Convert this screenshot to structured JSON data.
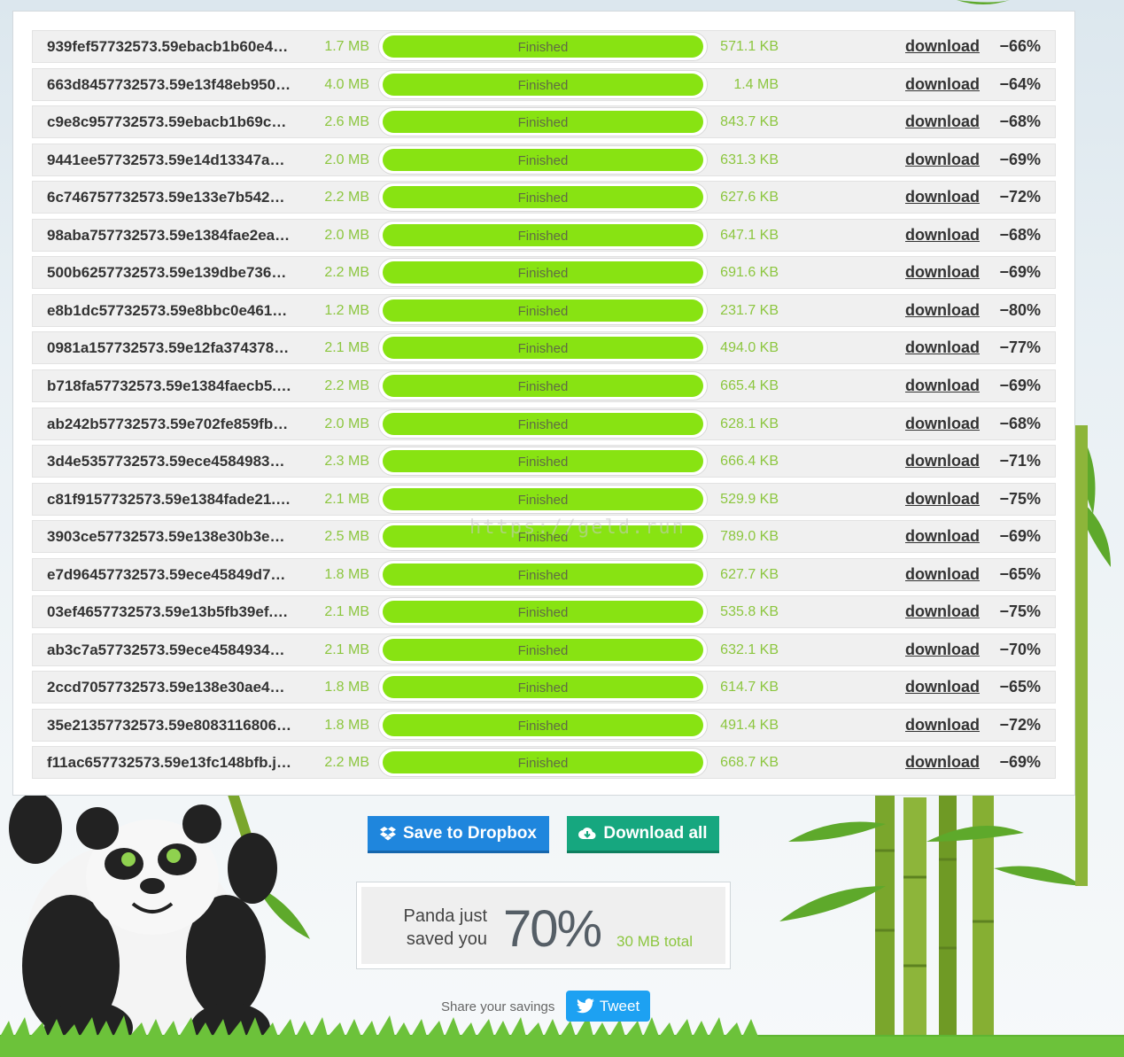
{
  "files": [
    {
      "name": "939fef57732573.59ebacb1b60e4…",
      "original": "1.7 MB",
      "status": "Finished",
      "progress": 100,
      "new_size": "571.1 KB",
      "download": "download",
      "saving": "−66%"
    },
    {
      "name": "663d8457732573.59e13f48eb950…",
      "original": "4.0 MB",
      "status": "Finished",
      "progress": 100,
      "new_size": "1.4 MB",
      "download": "download",
      "saving": "−64%"
    },
    {
      "name": "c9e8c957732573.59ebacb1b69c…",
      "original": "2.6 MB",
      "status": "Finished",
      "progress": 100,
      "new_size": "843.7 KB",
      "download": "download",
      "saving": "−68%"
    },
    {
      "name": "9441ee57732573.59e14d13347a…",
      "original": "2.0 MB",
      "status": "Finished",
      "progress": 100,
      "new_size": "631.3 KB",
      "download": "download",
      "saving": "−69%"
    },
    {
      "name": "6c746757732573.59e133e7b542…",
      "original": "2.2 MB",
      "status": "Finished",
      "progress": 100,
      "new_size": "627.6 KB",
      "download": "download",
      "saving": "−72%"
    },
    {
      "name": "98aba757732573.59e1384fae2ea…",
      "original": "2.0 MB",
      "status": "Finished",
      "progress": 100,
      "new_size": "647.1 KB",
      "download": "download",
      "saving": "−68%"
    },
    {
      "name": "500b6257732573.59e139dbe736…",
      "original": "2.2 MB",
      "status": "Finished",
      "progress": 100,
      "new_size": "691.6 KB",
      "download": "download",
      "saving": "−69%"
    },
    {
      "name": "e8b1dc57732573.59e8bbc0e461…",
      "original": "1.2 MB",
      "status": "Finished",
      "progress": 100,
      "new_size": "231.7 KB",
      "download": "download",
      "saving": "−80%"
    },
    {
      "name": "0981a157732573.59e12fa374378…",
      "original": "2.1 MB",
      "status": "Finished",
      "progress": 100,
      "new_size": "494.0 KB",
      "download": "download",
      "saving": "−77%"
    },
    {
      "name": "b718fa57732573.59e1384faecb5.…",
      "original": "2.2 MB",
      "status": "Finished",
      "progress": 100,
      "new_size": "665.4 KB",
      "download": "download",
      "saving": "−69%"
    },
    {
      "name": "ab242b57732573.59e702fe859fb…",
      "original": "2.0 MB",
      "status": "Finished",
      "progress": 100,
      "new_size": "628.1 KB",
      "download": "download",
      "saving": "−68%"
    },
    {
      "name": "3d4e5357732573.59ece4584983…",
      "original": "2.3 MB",
      "status": "Finished",
      "progress": 100,
      "new_size": "666.4 KB",
      "download": "download",
      "saving": "−71%"
    },
    {
      "name": "c81f9157732573.59e1384fade21.…",
      "original": "2.1 MB",
      "status": "Finished",
      "progress": 100,
      "new_size": "529.9 KB",
      "download": "download",
      "saving": "−75%"
    },
    {
      "name": "3903ce57732573.59e138e30b3e…",
      "original": "2.5 MB",
      "status": "Finished",
      "progress": 100,
      "new_size": "789.0 KB",
      "download": "download",
      "saving": "−69%"
    },
    {
      "name": "e7d96457732573.59ece45849d7…",
      "original": "1.8 MB",
      "status": "Finished",
      "progress": 100,
      "new_size": "627.7 KB",
      "download": "download",
      "saving": "−65%"
    },
    {
      "name": "03ef4657732573.59e13b5fb39ef.…",
      "original": "2.1 MB",
      "status": "Finished",
      "progress": 100,
      "new_size": "535.8 KB",
      "download": "download",
      "saving": "−75%"
    },
    {
      "name": "ab3c7a57732573.59ece4584934…",
      "original": "2.1 MB",
      "status": "Finished",
      "progress": 100,
      "new_size": "632.1 KB",
      "download": "download",
      "saving": "−70%"
    },
    {
      "name": "2ccd7057732573.59e138e30ae4…",
      "original": "1.8 MB",
      "status": "Finished",
      "progress": 100,
      "new_size": "614.7 KB",
      "download": "download",
      "saving": "−65%"
    },
    {
      "name": "35e21357732573.59e8083116806…",
      "original": "1.8 MB",
      "status": "Finished",
      "progress": 100,
      "new_size": "491.4 KB",
      "download": "download",
      "saving": "−72%"
    },
    {
      "name": "f11ac657732573.59e13fc148bfb.j…",
      "original": "2.2 MB",
      "status": "Finished",
      "progress": 100,
      "new_size": "668.7 KB",
      "download": "download",
      "saving": "−69%"
    }
  ],
  "actions": {
    "dropbox_label": "Save to Dropbox",
    "download_all_label": "Download all"
  },
  "savings": {
    "line1": "Panda just",
    "line2": "saved you",
    "percent": "70%",
    "total": "30 MB total"
  },
  "share": {
    "label": "Share your savings",
    "tweet_label": "Tweet"
  },
  "watermark": "https://geld.run",
  "colors": {
    "progress": "#88e312",
    "size_text": "#8cc63f",
    "dropbox": "#1f86dd",
    "download_all": "#16a77f",
    "twitter": "#1da1f2"
  },
  "icons": {
    "dropbox": "dropbox-icon",
    "download_all": "cloud-download-icon",
    "tweet": "twitter-bird-icon"
  }
}
